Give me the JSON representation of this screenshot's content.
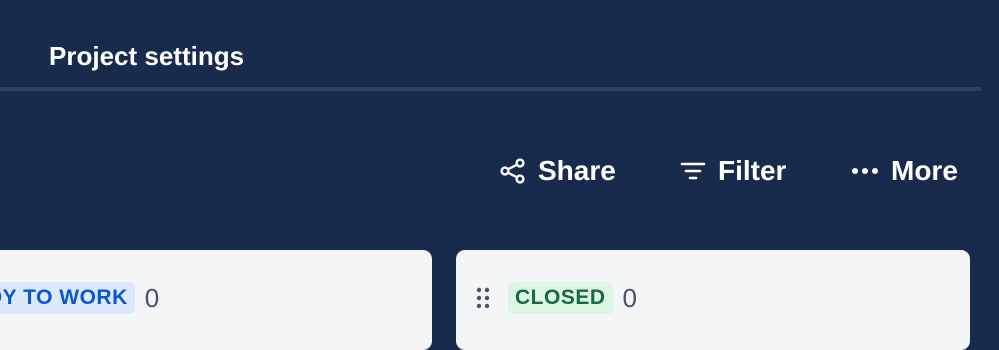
{
  "nav": {
    "project_settings_label": "Project settings"
  },
  "toolbar": {
    "share_label": "Share",
    "share_icon": "share-icon",
    "filter_label": "Filter",
    "filter_icon": "filter-icon",
    "more_label": "More",
    "more_icon": "ellipsis-icon"
  },
  "columns": [
    {
      "status_label": "DY TO WORK",
      "count": "0",
      "lozenge_color": "#0c55d1"
    },
    {
      "status_label": "CLOSED",
      "count": "0",
      "lozenge_color": "#1a6a3f",
      "handle_icon": "drag-handle-icon"
    }
  ],
  "colors": {
    "background": "#182b4d",
    "column_background": "#f4f5f7"
  }
}
